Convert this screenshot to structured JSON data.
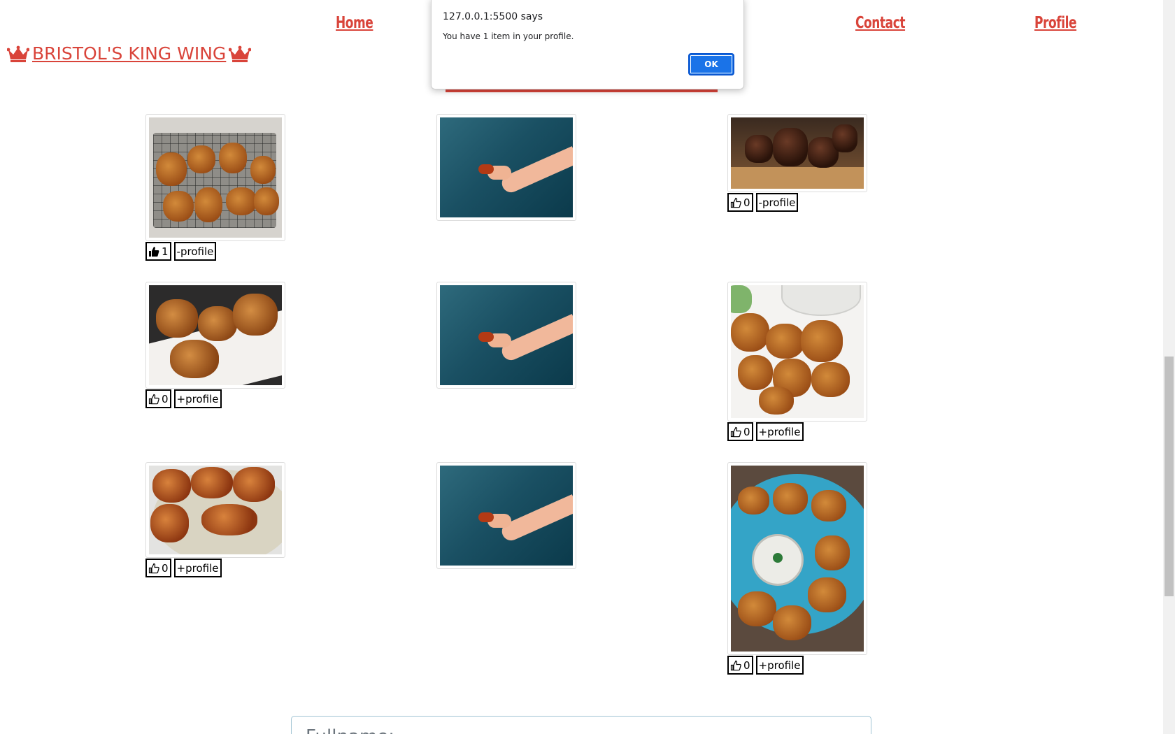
{
  "nav": {
    "home": "Home",
    "contact": "Contact",
    "profile": "Profile",
    "brand": "BRISTOL'S KING WING",
    "brand_icon": "crown-icon"
  },
  "colors": {
    "accent": "#d9443a",
    "ok_button": "#1a73e8"
  },
  "gallery": [
    {
      "id": "c1",
      "likes": "1",
      "liked": true,
      "profile": "-profile",
      "image": "fried-chicken-tray"
    },
    {
      "id": "c2",
      "likes": "",
      "profile": "",
      "image": "hand-holding-wing"
    },
    {
      "id": "c3",
      "likes": "0",
      "liked": false,
      "profile": "-profile",
      "image": "glazed-wings"
    },
    {
      "id": "c4",
      "likes": "0",
      "liked": false,
      "profile": "+profile",
      "image": "fried-chicken-plate"
    },
    {
      "id": "c5",
      "likes": "",
      "profile": "",
      "image": "hand-holding-wing"
    },
    {
      "id": "c6",
      "likes": "0",
      "liked": false,
      "profile": "+profile",
      "image": "cauliflower-wings-dip"
    },
    {
      "id": "c7",
      "likes": "0",
      "liked": false,
      "profile": "+profile",
      "image": "roast-chicken-plate"
    },
    {
      "id": "c8",
      "likes": "",
      "profile": "",
      "image": "hand-holding-wing"
    },
    {
      "id": "c9",
      "likes": "0",
      "liked": false,
      "profile": "+profile",
      "image": "cauliflower-bowl-ranch"
    }
  ],
  "form": {
    "fullname_placeholder": "Fullname:"
  },
  "dialog": {
    "title": "127.0.0.1:5500 says",
    "message": "You have 1 item in your profile.",
    "ok": "OK"
  }
}
